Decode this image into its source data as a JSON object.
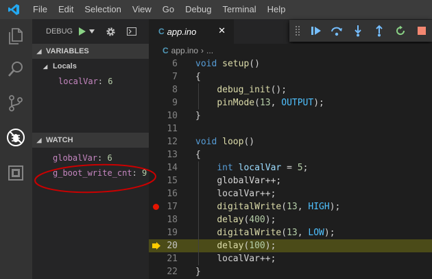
{
  "menu": [
    "File",
    "Edit",
    "Selection",
    "View",
    "Go",
    "Debug",
    "Terminal",
    "Help"
  ],
  "sidebar": {
    "debug_label": "DEBUG",
    "variables_header": "VARIABLES",
    "locals_label": "Locals",
    "locals": [
      {
        "name": "localVar",
        "value": "6"
      }
    ],
    "watch_header": "WATCH",
    "watch": [
      {
        "name": "globalVar",
        "value": "6"
      },
      {
        "name": "g_boot_write_cnt",
        "value": "9"
      }
    ]
  },
  "editor": {
    "tab_label": "app.ino",
    "tab_icon": "C",
    "breadcrumb_file": "app.ino",
    "breadcrumb_more": "...",
    "current_line": 20,
    "breakpoint_line": 17,
    "lines": [
      {
        "n": "6",
        "code": "void setup()"
      },
      {
        "n": "7",
        "code": "{"
      },
      {
        "n": "8",
        "code": "    debug_init();"
      },
      {
        "n": "9",
        "code": "    pinMode(13, OUTPUT);"
      },
      {
        "n": "10",
        "code": "}"
      },
      {
        "n": "11",
        "code": ""
      },
      {
        "n": "12",
        "code": "void loop()"
      },
      {
        "n": "13",
        "code": "{"
      },
      {
        "n": "14",
        "code": "    int localVar = 5;"
      },
      {
        "n": "15",
        "code": "    globalVar++;"
      },
      {
        "n": "16",
        "code": "    localVar++;"
      },
      {
        "n": "17",
        "code": "    digitalWrite(13, HIGH);"
      },
      {
        "n": "18",
        "code": "    delay(400);"
      },
      {
        "n": "19",
        "code": "    digitalWrite(13, LOW);"
      },
      {
        "n": "20",
        "code": "    delay(100);"
      },
      {
        "n": "21",
        "code": "    localVar++;"
      },
      {
        "n": "22",
        "code": "}"
      }
    ]
  },
  "colors": {
    "accent": "#007acc",
    "annotation": "#cc0000",
    "breakpoint": "#e51400",
    "current_line_bg": "#4b4b18",
    "continue": "#89d185",
    "restart": "#89d185",
    "stop": "#f48771"
  },
  "icons": {
    "activity": [
      "explorer-icon",
      "search-icon",
      "source-control-icon",
      "debug-icon",
      "extensions-icon"
    ],
    "debug_toolbar": [
      "drag-handle-icon",
      "continue-icon",
      "step-over-icon",
      "step-into-icon",
      "step-out-icon",
      "restart-icon",
      "stop-icon"
    ]
  }
}
